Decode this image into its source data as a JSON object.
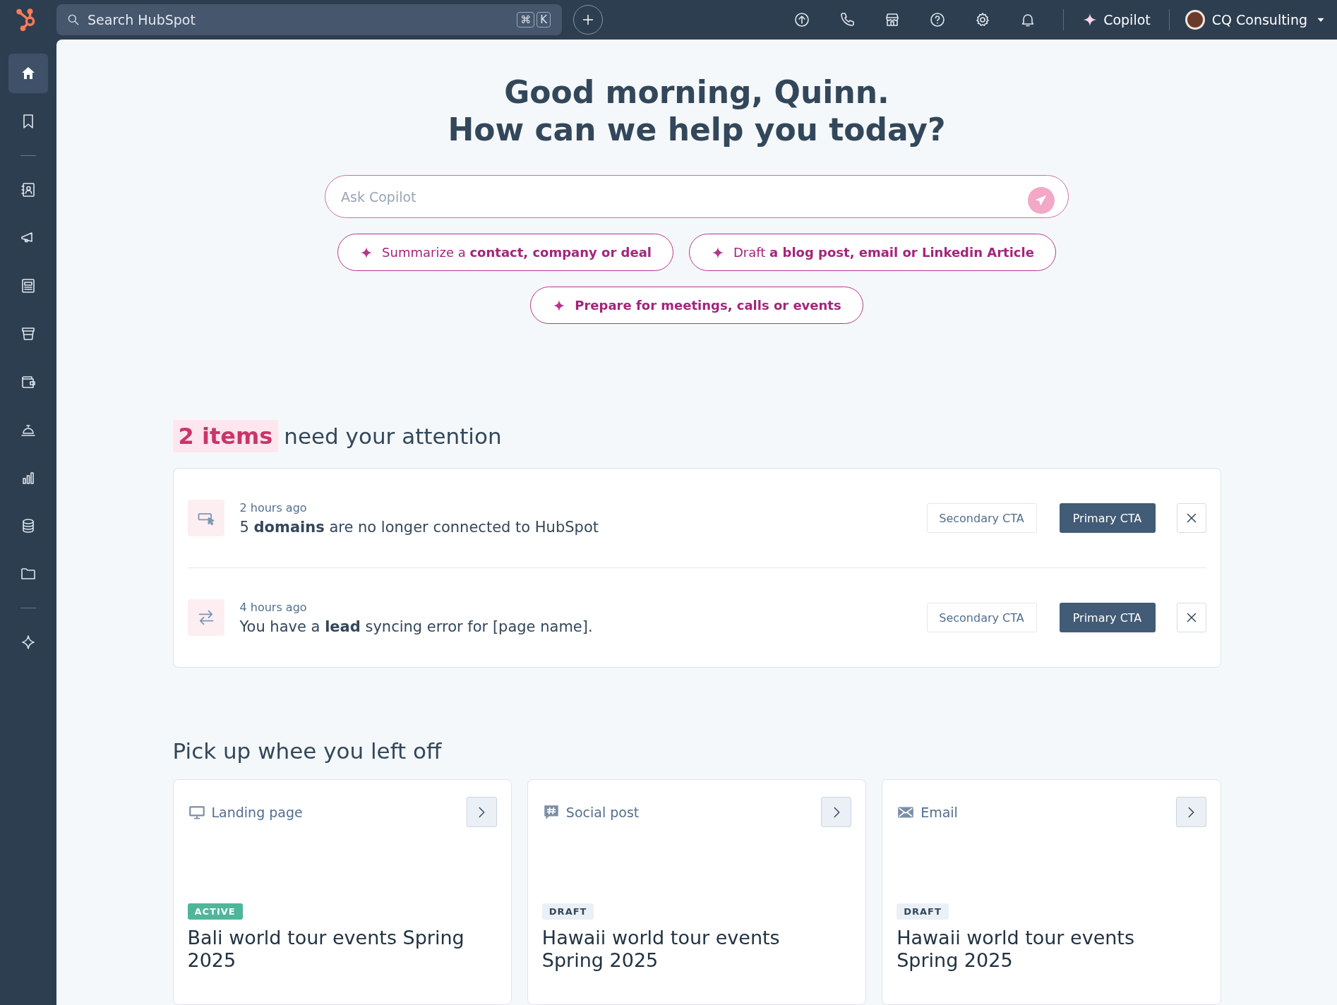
{
  "topbar": {
    "search": {
      "placeholder": "Search HubSpot",
      "keys": [
        "⌘",
        "K"
      ]
    },
    "copilot": "Copilot",
    "account": "CQ Consulting"
  },
  "sidebar": {
    "items": [
      {
        "kind": "home",
        "selected": true
      },
      {
        "kind": "bookmark",
        "selected": false
      },
      {
        "kind": "divider"
      },
      {
        "kind": "contacts",
        "selected": false
      },
      {
        "kind": "marketing",
        "selected": false
      },
      {
        "kind": "content",
        "selected": false
      },
      {
        "kind": "sales",
        "selected": false
      },
      {
        "kind": "commerce",
        "selected": false
      },
      {
        "kind": "service",
        "selected": false
      },
      {
        "kind": "reporting",
        "selected": false
      },
      {
        "kind": "data",
        "selected": false
      },
      {
        "kind": "library",
        "selected": false
      },
      {
        "kind": "divider"
      },
      {
        "kind": "ai",
        "selected": false
      }
    ]
  },
  "greeting": [
    "Good morning, Quinn.",
    "How can we help you today?"
  ],
  "prompt": {
    "placeholder": "Ask Copilot"
  },
  "suggestions": [
    [
      "Summarize a **contact, company or deal**",
      "Draft **a blog post, email or Linkedin Article**"
    ],
    [
      "**Prepare for meetings, calls or events**"
    ]
  ],
  "attention": {
    "count": "2 items",
    "rest": "need your attention",
    "items": [
      {
        "kind": "domain",
        "time": "2 hours ago",
        "text": "5 **domains** are no longer connected to HubSpot",
        "secondary": "Secondary CTA",
        "primary": "Primary CTA"
      },
      {
        "kind": "sync",
        "time": "4 hours ago",
        "text": "You have a **lead** syncing error for [page name].",
        "secondary": "Secondary CTA",
        "primary": "Primary CTA"
      }
    ]
  },
  "recent": {
    "title": "Pick up whee you left off",
    "cards": [
      {
        "kind": "landing",
        "type": "Landing page",
        "status": {
          "label": "ACTIVE",
          "kind": "active"
        },
        "title": "Bali world tour events Spring 2025"
      },
      {
        "kind": "social",
        "type": "Social post",
        "status": {
          "label": "DRAFT",
          "kind": "draft"
        },
        "title": "Hawaii world tour events Spring 2025"
      },
      {
        "kind": "email",
        "type": "Email",
        "status": {
          "label": "DRAFT",
          "kind": "draft"
        },
        "title": "Hawaii world tour events Spring 2025"
      }
    ]
  }
}
